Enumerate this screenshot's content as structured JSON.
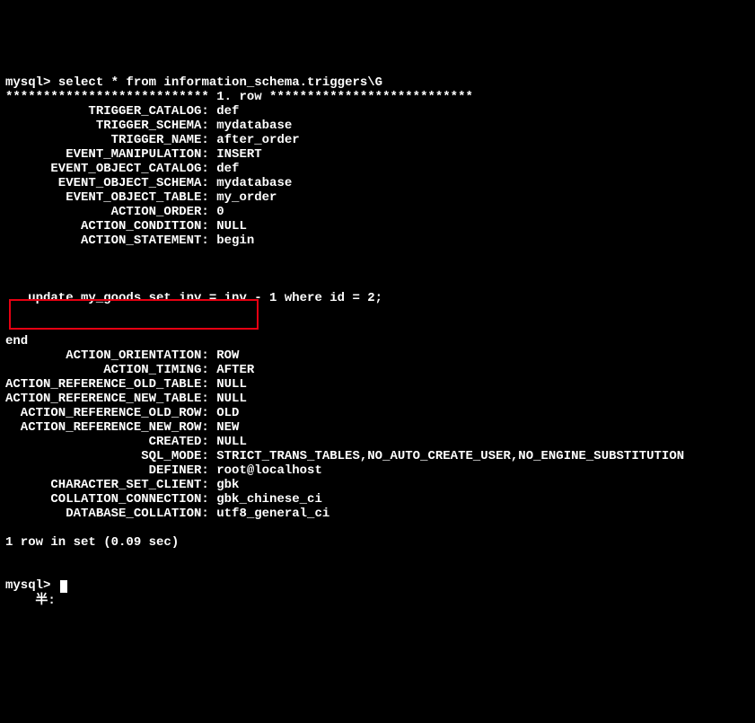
{
  "prompt1": "mysql> ",
  "command": "select * from information_schema.triggers\\G",
  "separator": "*************************** 1. row ***************************",
  "rows": [
    {
      "label": "TRIGGER_CATALOG",
      "value": "def"
    },
    {
      "label": "TRIGGER_SCHEMA",
      "value": "mydatabase"
    },
    {
      "label": "TRIGGER_NAME",
      "value": "after_order"
    },
    {
      "label": "EVENT_MANIPULATION",
      "value": "INSERT"
    },
    {
      "label": "EVENT_OBJECT_CATALOG",
      "value": "def"
    },
    {
      "label": "EVENT_OBJECT_SCHEMA",
      "value": "mydatabase"
    },
    {
      "label": "EVENT_OBJECT_TABLE",
      "value": "my_order"
    },
    {
      "label": "ACTION_ORDER",
      "value": "0"
    },
    {
      "label": "ACTION_CONDITION",
      "value": "NULL"
    },
    {
      "label": "ACTION_STATEMENT",
      "value": "begin"
    }
  ],
  "statement_body": "   update my_goods set inv = inv - 1 where id = 2;",
  "end_line": "end",
  "rows2": [
    {
      "label": "ACTION_ORIENTATION",
      "value": "ROW"
    },
    {
      "label": "ACTION_TIMING",
      "value": "AFTER"
    },
    {
      "label": "ACTION_REFERENCE_OLD_TABLE",
      "value": "NULL"
    },
    {
      "label": "ACTION_REFERENCE_NEW_TABLE",
      "value": "NULL"
    },
    {
      "label": "ACTION_REFERENCE_OLD_ROW",
      "value": "OLD"
    },
    {
      "label": "ACTION_REFERENCE_NEW_ROW",
      "value": "NEW"
    },
    {
      "label": "CREATED",
      "value": "NULL"
    },
    {
      "label": "SQL_MODE",
      "value": "STRICT_TRANS_TABLES,NO_AUTO_CREATE_USER,NO_ENGINE_SUBSTITUTION"
    },
    {
      "label": "DEFINER",
      "value": "root@localhost"
    },
    {
      "label": "CHARACTER_SET_CLIENT",
      "value": "gbk"
    },
    {
      "label": "COLLATION_CONNECTION",
      "value": "gbk_chinese_ci"
    },
    {
      "label": "DATABASE_COLLATION",
      "value": "utf8_general_ci"
    }
  ],
  "footer": "1 row in set (0.09 sec)",
  "prompt2": "mysql> ",
  "ime_label": "半:"
}
